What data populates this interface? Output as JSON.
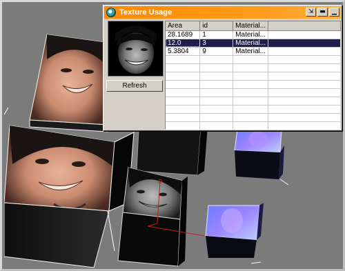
{
  "window": {
    "title": "Texture Usage",
    "buttons": {
      "pin": "⇲",
      "minimize": "▬",
      "close": "▁"
    },
    "refresh_label": "Refresh"
  },
  "table": {
    "columns": [
      "Area",
      "id",
      "Material...",
      ""
    ],
    "rows": [
      {
        "area": "28.1689",
        "id": "1",
        "material": "Material...",
        "selected": false
      },
      {
        "area": "12.0",
        "id": "3",
        "material": "Material...",
        "selected": true
      },
      {
        "area": "5.3804",
        "id": "9",
        "material": "Material...",
        "selected": false
      }
    ],
    "empty_rows": 10
  },
  "viewport": {
    "objects": [
      "textured-cube-top-left",
      "textured-cube-large-left",
      "textured-cube-dark-back",
      "textured-cube-blue-back",
      "textured-cube-gray-center",
      "textured-cube-blue-small"
    ]
  },
  "colors": {
    "titlebar": "#ff9000",
    "selection": "#1f1f4f",
    "viewport_bg": "#7b7b7b"
  }
}
